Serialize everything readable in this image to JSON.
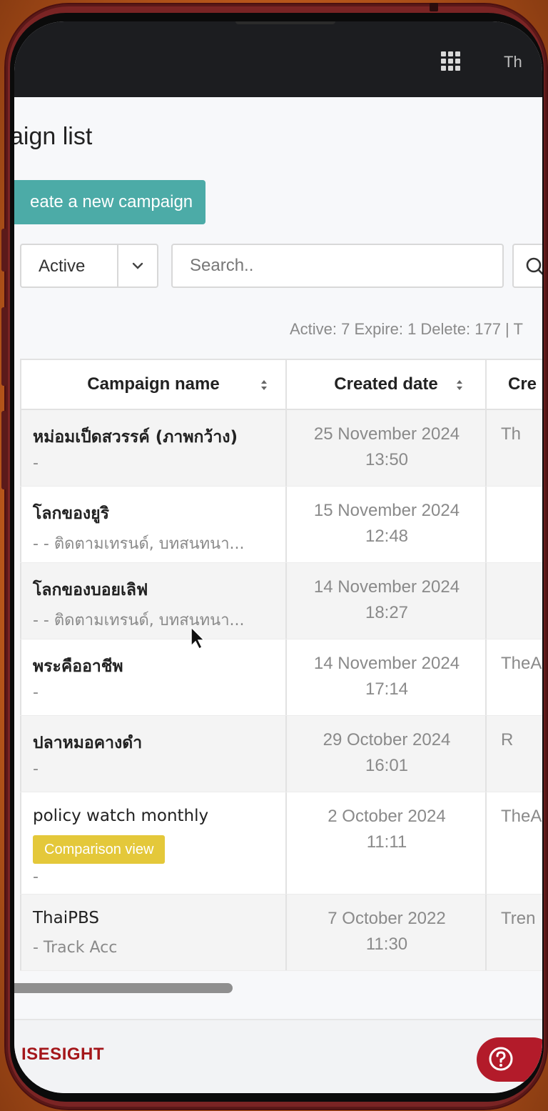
{
  "topbar": {
    "apps_icon": "grid-icon",
    "user_label": "Th"
  },
  "page": {
    "title": "aign list",
    "create_button_label": "eate a new campaign"
  },
  "filters": {
    "status_value": "Active",
    "search_placeholder": "Search..",
    "search_icon": "search-icon"
  },
  "summary": "Active: 7 Expire: 1 Delete: 177 | T",
  "table": {
    "headers": {
      "campaign_name": "Campaign name",
      "created_date": "Created date",
      "created_by": "Cre"
    },
    "rows": [
      {
        "name": "หม่อมเป็ดสวรรค์ (ภาพกว้าง)",
        "sub": "-",
        "badge": "",
        "date": "25 November 2024",
        "time": "13:50",
        "creator": "Th"
      },
      {
        "name": "โลกของยูริ",
        "sub": "- - ติดตามเทรนด์, บทสนทนา...",
        "badge": "",
        "date": "15 November 2024",
        "time": "12:48",
        "creator": ""
      },
      {
        "name": "โลกของบอยเลิฟ",
        "sub": "- - ติดตามเทรนด์, บทสนทนา...",
        "badge": "",
        "date": "14 November 2024",
        "time": "18:27",
        "creator": ""
      },
      {
        "name": "พระคืออาชีพ",
        "sub": "-",
        "badge": "",
        "date": "14 November 2024",
        "time": "17:14",
        "creator": "TheA"
      },
      {
        "name": "ปลาหมอคางดำ",
        "sub": "-",
        "badge": "",
        "date": "29 October 2024",
        "time": "16:01",
        "creator": "R"
      },
      {
        "name": "policy watch monthly",
        "sub": "-",
        "badge": "Comparison view",
        "date": "2 October 2024",
        "time": "11:11",
        "creator": "TheA"
      },
      {
        "name": "ThaiPBS",
        "sub": "- Track Acc",
        "badge": "",
        "date": "7 October 2022",
        "time": "11:30",
        "creator": "Tren"
      }
    ]
  },
  "footer": {
    "logo_text": "ISESIGHT",
    "help_icon": "help-icon"
  },
  "colors": {
    "accent": "#4caba7",
    "badge": "#e4c83a",
    "brand": "#a4161a",
    "topbar": "#1c1d20"
  }
}
